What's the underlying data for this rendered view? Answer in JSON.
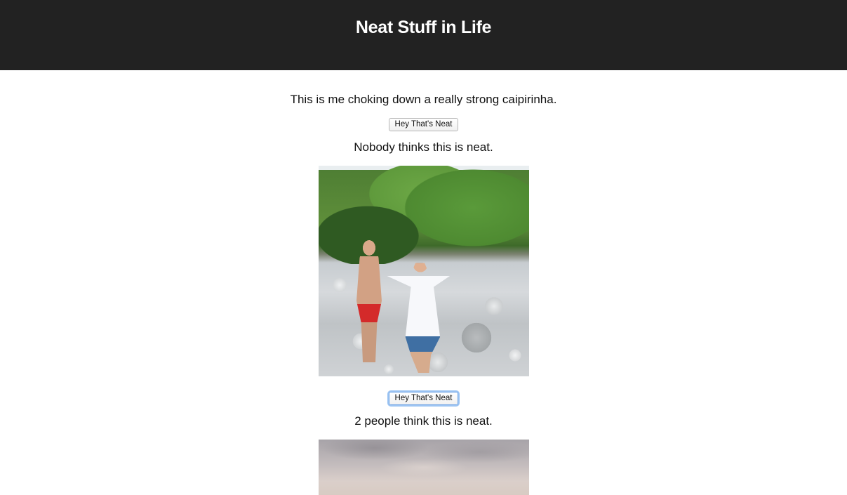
{
  "header": {
    "title": "Neat Stuff in Life"
  },
  "posts": [
    {
      "caption": "This is me choking down a really strong caipirinha.",
      "button_label": "Hey That's Neat",
      "neat_count_text": "Nobody thinks this is neat."
    },
    {
      "button_label": "Hey That's Neat",
      "neat_count_text": "2 people think this is neat."
    }
  ],
  "colors": {
    "header_bg": "#222222",
    "header_text": "#ffffff",
    "page_bg": "#ffffff",
    "button_focus": "#9cc4f3"
  }
}
